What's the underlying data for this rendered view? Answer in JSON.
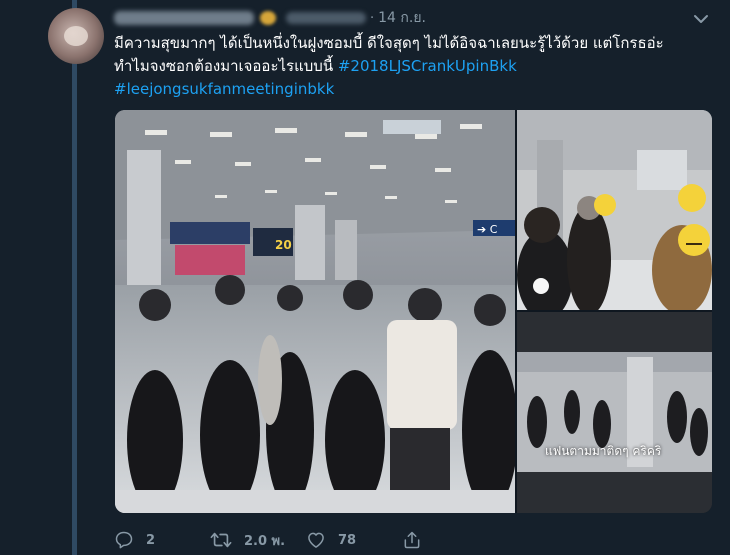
{
  "tweet": {
    "date_sep": "·",
    "date": "14 ก.ย.",
    "text": "มีความสุขมากๆ ได้เป็นหนึ่งในฝูงซอมบี้ ดีใจสุดๆ ไม่ได้อิจฉาเลยนะรู้ไว้ด้วย แต่โกรธอ่ะ ทำไมจงซอกต้องมาเจออะไรแบบนี้",
    "hashtag1": "#2018LJSCrankUpinBkk",
    "hashtag2": "#leejongsukfanmeetinginbkk",
    "photo_caption_overlay": "แฟนตามมาติดๆ คริคริ",
    "photo_airport_sign": "20",
    "photo_arrow_sign": "➔ C"
  },
  "actions": {
    "reply_count": "2",
    "retweet_count": "2.0 พ.",
    "like_count": "78"
  },
  "icons": {
    "menu": "chevron-down-icon",
    "reply": "reply-icon",
    "retweet": "retweet-icon",
    "like": "heart-icon",
    "share": "share-icon"
  },
  "colors": {
    "background": "#15202b",
    "text": "#ffffff",
    "muted": "#8899a6",
    "link": "#1da1f2",
    "thread_line": "#2f4a63"
  }
}
